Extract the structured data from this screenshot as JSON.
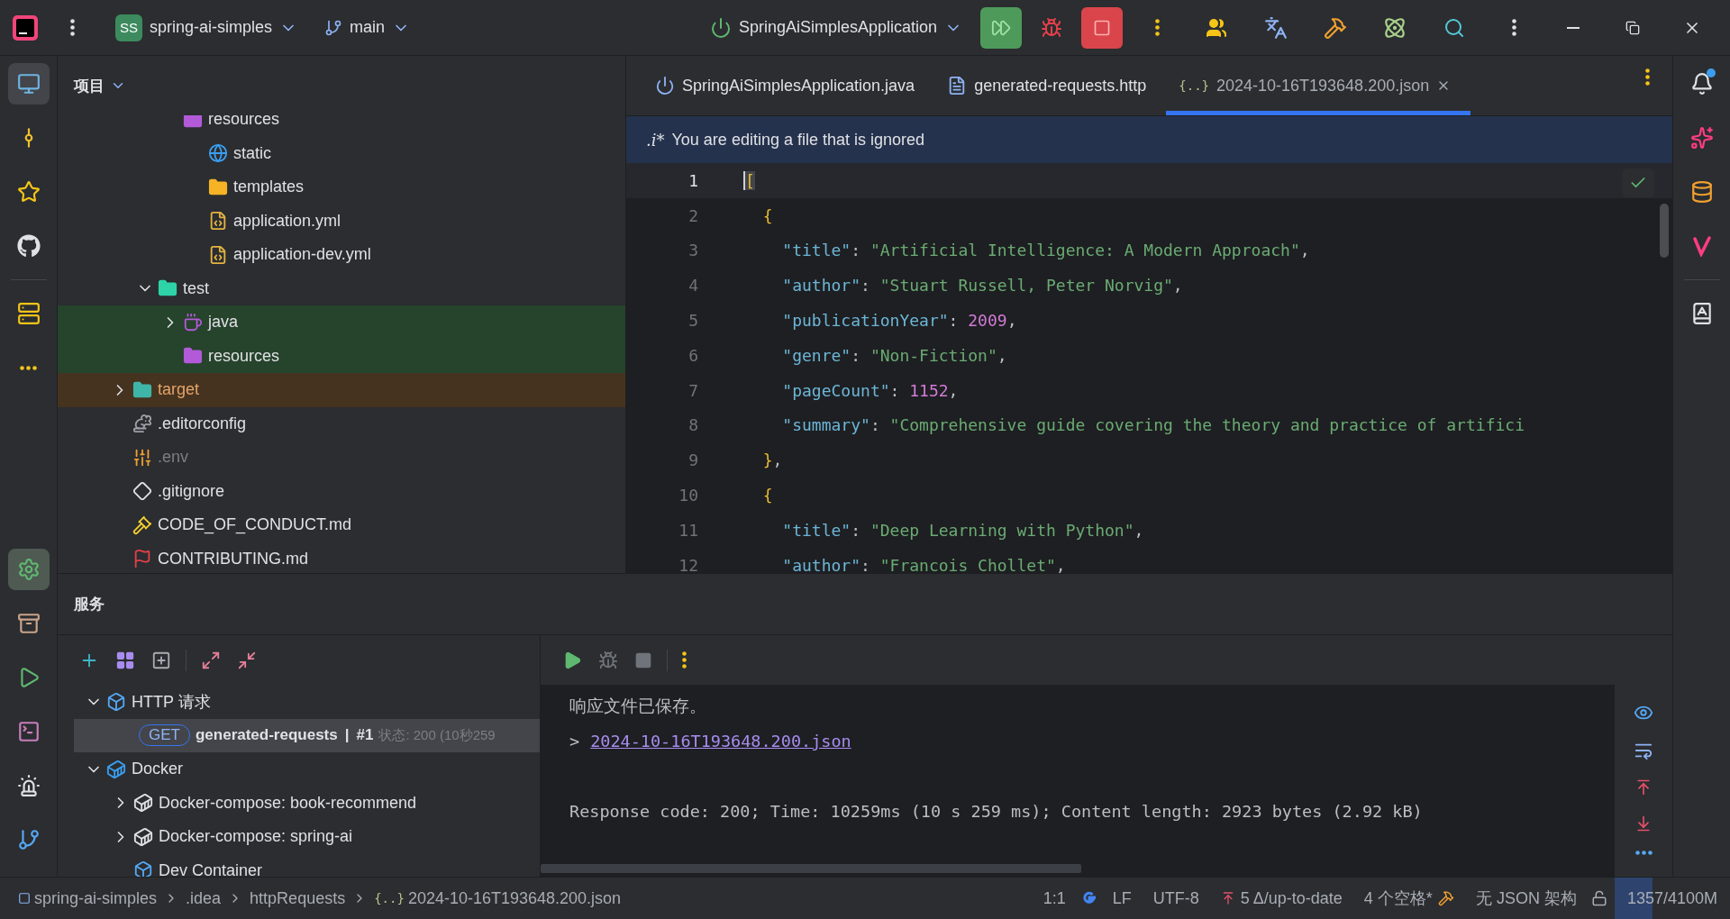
{
  "toolbar": {
    "project_badge": "SS",
    "project": "spring-ai-simples",
    "branch": "main",
    "run_config": "SpringAiSimplesApplication"
  },
  "tool_strip": {
    "top": [
      {
        "kind": "monitor",
        "selected": true
      },
      {
        "kind": "commit",
        "selected": false
      },
      {
        "kind": "star",
        "selected": false
      },
      {
        "kind": "github",
        "selected": false
      },
      {
        "kind": "structure",
        "selected": false
      },
      {
        "kind": "more",
        "selected": false
      }
    ],
    "bottom": [
      {
        "kind": "services",
        "selected": true
      },
      {
        "kind": "box",
        "selected": false
      },
      {
        "kind": "run",
        "selected": false
      },
      {
        "kind": "terminal",
        "selected": false
      },
      {
        "kind": "problems",
        "selected": false
      },
      {
        "kind": "git",
        "selected": false
      }
    ]
  },
  "project_panel": {
    "title": "项目",
    "tree": [
      {
        "children": [
          {
            "children": [
              {
                "label": "resources",
                "kind": "resource-folder",
                "children": [
                  {
                    "label": "static",
                    "kind": "web-folder"
                  },
                  {
                    "label": "templates",
                    "kind": "template-folder"
                  },
                  {
                    "label": "application.yml",
                    "kind": "yaml"
                  },
                  {
                    "label": "application-dev.yml",
                    "kind": "yaml"
                  }
                ]
              }
            ]
          },
          {
            "label": "test",
            "kind": "test-folder",
            "expanded": true,
            "children": [
              {
                "label": "java",
                "kind": "source-folder",
                "expanded": false,
                "test_scope": true
              },
              {
                "label": "resources",
                "kind": "resource-folder",
                "test_scope": true
              }
            ]
          }
        ]
      },
      {
        "label": "target",
        "kind": "excluded-folder",
        "expanded": false,
        "excluded": true
      },
      {
        "label": ".editorconfig",
        "kind": "config"
      },
      {
        "label": ".env",
        "kind": "env",
        "ignored": true
      },
      {
        "label": ".gitignore",
        "kind": "gitignore"
      },
      {
        "label": "CODE_OF_CONDUCT.md",
        "kind": "conduct"
      },
      {
        "label": "CONTRIBUTING.md",
        "kind": "contributing"
      }
    ]
  },
  "editor": {
    "tabs": [
      {
        "label": "SpringAiSimplesApplication.java",
        "kind": "java",
        "selected": false
      },
      {
        "label": "generated-requests.http",
        "kind": "http",
        "selected": false
      },
      {
        "label": "2024-10-16T193648.200.json",
        "kind": "json",
        "badge": "{..}",
        "selected": true
      }
    ],
    "banner": {
      "icon_text": ".i*",
      "text": "You are editing a file that is ignored"
    },
    "lines": [
      {
        "number": "1",
        "current": true,
        "tokens": [
          {
            "kind": "brace",
            "text": "["
          }
        ]
      },
      {
        "number": "2",
        "current": false,
        "tokens": [
          {
            "kind": "brace",
            "text": "  {"
          }
        ]
      },
      {
        "number": "3",
        "current": false,
        "tokens": [
          {
            "kind": "key",
            "text": "    \"title\""
          },
          {
            "kind": "punct",
            "text": ": "
          },
          {
            "kind": "string",
            "text": "\"Artificial Intelligence: A Modern Approach\""
          },
          {
            "kind": "punct",
            "text": ","
          }
        ]
      },
      {
        "number": "4",
        "current": false,
        "tokens": [
          {
            "kind": "key",
            "text": "    \"author\""
          },
          {
            "kind": "punct",
            "text": ": "
          },
          {
            "kind": "string",
            "text": "\"Stuart Russell, Peter Norvig\""
          },
          {
            "kind": "punct",
            "text": ","
          }
        ]
      },
      {
        "number": "5",
        "current": false,
        "tokens": [
          {
            "kind": "key",
            "text": "    \"publicationYear\""
          },
          {
            "kind": "punct",
            "text": ": "
          },
          {
            "kind": "number",
            "text": "2009"
          },
          {
            "kind": "punct",
            "text": ","
          }
        ]
      },
      {
        "number": "6",
        "current": false,
        "tokens": [
          {
            "kind": "key",
            "text": "    \"genre\""
          },
          {
            "kind": "punct",
            "text": ": "
          },
          {
            "kind": "string",
            "text": "\"Non-Fiction\""
          },
          {
            "kind": "punct",
            "text": ","
          }
        ]
      },
      {
        "number": "7",
        "current": false,
        "tokens": [
          {
            "kind": "key",
            "text": "    \"pageCount\""
          },
          {
            "kind": "punct",
            "text": ": "
          },
          {
            "kind": "number",
            "text": "1152"
          },
          {
            "kind": "punct",
            "text": ","
          }
        ]
      },
      {
        "number": "8",
        "current": false,
        "tokens": [
          {
            "kind": "key",
            "text": "    \"summary\""
          },
          {
            "kind": "punct",
            "text": ": "
          },
          {
            "kind": "string",
            "text": "\"Comprehensive guide covering the theory and practice of artifici"
          }
        ]
      },
      {
        "number": "9",
        "current": false,
        "tokens": [
          {
            "kind": "brace",
            "text": "  }"
          },
          {
            "kind": "punct",
            "text": ","
          }
        ]
      },
      {
        "number": "10",
        "current": false,
        "tokens": [
          {
            "kind": "brace",
            "text": "  {"
          }
        ]
      },
      {
        "number": "11",
        "current": false,
        "tokens": [
          {
            "kind": "key",
            "text": "    \"title\""
          },
          {
            "kind": "punct",
            "text": ": "
          },
          {
            "kind": "string",
            "text": "\"Deep Learning with Python\""
          },
          {
            "kind": "punct",
            "text": ","
          }
        ]
      },
      {
        "number": "12",
        "current": false,
        "tokens": [
          {
            "kind": "key",
            "text": "    \"author\""
          },
          {
            "kind": "punct",
            "text": ": "
          },
          {
            "kind": "string",
            "text": "\"Francois Chollet\""
          },
          {
            "kind": "punct",
            "text": ","
          }
        ]
      }
    ]
  },
  "services": {
    "title": "服务",
    "tree": [
      {
        "label": "HTTP 请求",
        "kind": "http",
        "expanded": true,
        "selected": false,
        "children": [
          {
            "kind": "request",
            "method": "GET",
            "label": "generated-requests",
            "separator": "|",
            "run": "#1",
            "status": "状态: 200 (10秒259",
            "selected": true
          }
        ]
      },
      {
        "label": "Docker",
        "kind": "docker",
        "expanded": true,
        "selected": false,
        "children": [
          {
            "label": "Docker-compose: book-recommend",
            "kind": "compose",
            "expanded": false,
            "selected": false
          },
          {
            "label": "Docker-compose: spring-ai",
            "kind": "compose",
            "expanded": false,
            "selected": false
          },
          {
            "label": "Dev Container",
            "kind": "devcontainer",
            "selected": false
          }
        ]
      }
    ],
    "output": {
      "blocks": [
        [
          {
            "kind": "text",
            "text": "响应文件已保存。"
          },
          {
            "kind": "link",
            "prefix": ">",
            "text": "2024-10-16T193648.200.json"
          }
        ],
        [
          {
            "kind": "text",
            "text": "Response code: 200; Time: 10259ms (10 s 259 ms); Content length: 2923 bytes (2.92 kB)"
          }
        ]
      ]
    }
  },
  "status_bar": {
    "breadcrumbs": [
      {
        "kind": "module",
        "label": "spring-ai-simples"
      },
      {
        "kind": "folder",
        "label": ".idea"
      },
      {
        "kind": "folder",
        "label": "httpRequests"
      },
      {
        "kind": "json",
        "badge": "{..}",
        "label": "2024-10-16T193648.200.json"
      }
    ],
    "position": "1:1",
    "line_ending": "LF",
    "encoding": "UTF-8",
    "vcs": "5 Δ/up-to-date",
    "indent": "4 个空格*",
    "schema": "无 JSON 架构",
    "memory": {
      "text": "1357/4100M",
      "level": 0.33
    }
  }
}
